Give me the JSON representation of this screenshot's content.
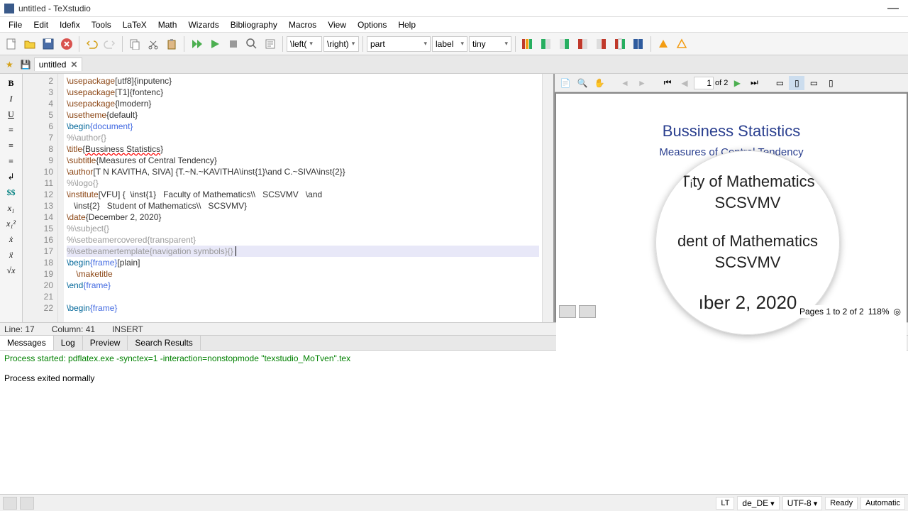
{
  "window": {
    "title": "untitled - TeXstudio"
  },
  "menu": [
    "File",
    "Edit",
    "Idefix",
    "Tools",
    "LaTeX",
    "Math",
    "Wizards",
    "Bibliography",
    "Macros",
    "View",
    "Options",
    "Help"
  ],
  "combos": {
    "left": "\\left(",
    "right": "\\right)",
    "part": "part",
    "label": "label",
    "size": "tiny"
  },
  "tab": {
    "name": "untitled"
  },
  "leftbar": [
    "B",
    "I",
    "U",
    "≡",
    "≡",
    "≡",
    "↲",
    "$$",
    "x₁",
    "x₁²",
    "ẋ",
    "ẍ",
    "√x"
  ],
  "gutter_start": 2,
  "code": [
    {
      "raw": "\\usepackage[utf8]{inputenc}"
    },
    {
      "raw": "\\usepackage[T1]{fontenc}"
    },
    {
      "raw": "\\usepackage{lmodern}"
    },
    {
      "raw": "\\usetheme{default}"
    },
    {
      "begin": "\\begin",
      "arg": "{document}"
    },
    {
      "cm": "%\\author{}"
    },
    {
      "cmd": "\\title",
      "body": "{Bussiness Statistics}",
      "err": true
    },
    {
      "cmd": "\\subtitle",
      "body": "{Measures of Central Tendency}"
    },
    {
      "cmd": "\\author",
      "body": "[T N KAVITHA, SIVA] {T.~N.~KAVITHA\\inst{1}\\and C.~SIVA\\inst{2}}"
    },
    {
      "cm": "%\\logo{}"
    },
    {
      "cmd": "\\institute",
      "body": "[VFU] {  \\inst{1}   Faculty of Mathematics\\\\   SCSVMV   \\and"
    },
    {
      "cont": "   \\inst{2}   Student of Mathematics\\\\   SCSVMV}"
    },
    {
      "cmd": "\\date",
      "body": "{December 2, 2020}"
    },
    {
      "cm": "%\\subject{}"
    },
    {
      "cm": "%\\setbeamercovered{transparent}"
    },
    {
      "cm": "%\\setbeamertemplate{navigation symbols}{}",
      "hl": true,
      "cursor": true
    },
    {
      "begin": "\\begin",
      "arg": "{frame}",
      "opt": "[plain]"
    },
    {
      "cmd": "    \\maketitle"
    },
    {
      "begin": "\\end",
      "arg": "{frame}"
    },
    {
      "empty": true
    },
    {
      "begin": "\\begin",
      "arg": "{frame}"
    }
  ],
  "status": {
    "line": "Line: 17",
    "col": "Column: 41",
    "mode": "INSERT"
  },
  "btabs": [
    "Messages",
    "Log",
    "Preview",
    "Search Results"
  ],
  "messages": {
    "m1": "Process started: pdflatex.exe -synctex=1 -interaction=nonstopmode \"texstudio_MoTven\".tex",
    "m2": "Process exited normally"
  },
  "preview": {
    "page": "1",
    "total": "of 2",
    "title": "Bussiness Statistics",
    "subtitle": "Measures of Central Tendency",
    "mag": [
      "Tᵢty of Mathematics",
      "SCSVMV",
      "",
      "dent of Mathematics",
      "SCSVMV",
      "",
      "ıber 2, 2020"
    ],
    "pages": "Pages 1 to 2 of 2",
    "zoom": "118%"
  },
  "footer": {
    "lt": "LT",
    "lang": "de_DE",
    "enc": "UTF-8",
    "ready": "Ready",
    "auto": "Automatic"
  }
}
